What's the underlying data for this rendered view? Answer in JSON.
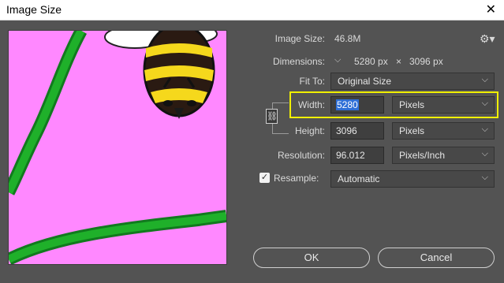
{
  "window": {
    "title": "Image Size"
  },
  "icons": {
    "close": "close-icon",
    "settings": "gear-icon",
    "link": "chain-link-icon",
    "chevron": "chevron-down-icon",
    "check": "checkmark-icon"
  },
  "info": {
    "image_size_label": "Image Size:",
    "image_size_value": "46.8M",
    "dimensions_label": "Dimensions:",
    "dimensions_width": "5280 px",
    "dimensions_x": "×",
    "dimensions_height": "3096 px"
  },
  "fit_to": {
    "label": "Fit To:",
    "value": "Original Size"
  },
  "width": {
    "label": "Width:",
    "value": "5280",
    "unit": "Pixels"
  },
  "height": {
    "label": "Height:",
    "value": "3096",
    "unit": "Pixels"
  },
  "resolution": {
    "label": "Resolution:",
    "value": "96.012",
    "unit": "Pixels/Inch"
  },
  "resample": {
    "label": "Resample:",
    "checked": true,
    "value": "Automatic"
  },
  "buttons": {
    "ok": "OK",
    "cancel": "Cancel"
  },
  "colors": {
    "background": "#535353",
    "preview_bg": "#ff88ff",
    "highlight": "#f1f000",
    "selection": "#2f6fd6"
  }
}
